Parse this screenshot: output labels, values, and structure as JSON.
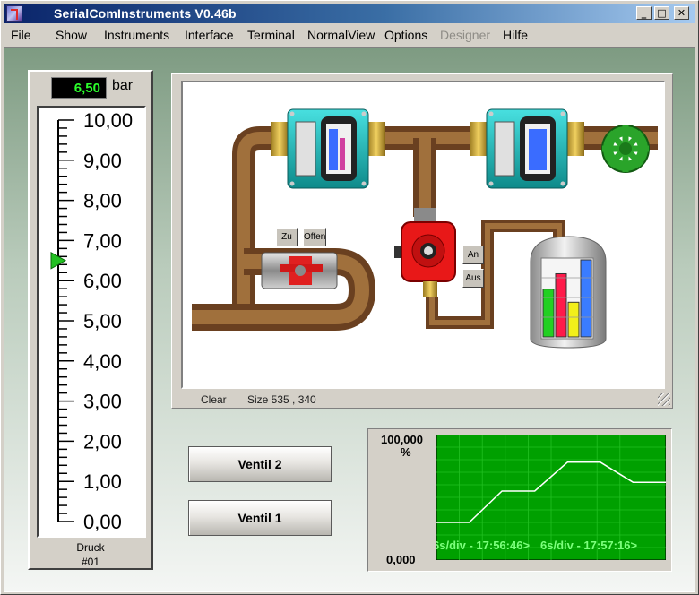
{
  "window": {
    "title": "SerialComInstruments  V0.46b",
    "buttons": [
      "_",
      "□",
      "✕"
    ]
  },
  "menu": [
    {
      "label": "File",
      "disabled": false
    },
    {
      "label": "Show",
      "disabled": false
    },
    {
      "label": "Instruments",
      "disabled": false
    },
    {
      "label": "Interface",
      "disabled": false
    },
    {
      "label": "Terminal",
      "disabled": false
    },
    {
      "label": "NormalView",
      "disabled": false
    },
    {
      "label": "Options",
      "disabled": false
    },
    {
      "label": "Designer",
      "disabled": true
    },
    {
      "label": "Hilfe",
      "disabled": false
    }
  ],
  "gauge": {
    "value_display": "6,50",
    "value": 6.5,
    "unit": "bar",
    "min": 0,
    "max": 10,
    "ticks": [
      "10,00",
      "9,00",
      "8,00",
      "7,00",
      "6,00",
      "5,00",
      "4,00",
      "3,00",
      "2,00",
      "1,00",
      "0,00"
    ],
    "name": "Druck",
    "id": "#01",
    "pointer_color": "#22c022"
  },
  "diagram": {
    "valve_buttons": {
      "close": "Zu",
      "open": "Offen"
    },
    "pump_buttons": {
      "on": "An",
      "off": "Aus"
    },
    "status_clear": "Clear",
    "status_size": "Size 535 , 340",
    "pipe_color": "#8b5a2b",
    "tank_bars": [
      {
        "color": "#22d022",
        "level": 0.62
      },
      {
        "color": "#ff1a4a",
        "level": 0.82
      },
      {
        "color": "#f2ef1a",
        "level": 0.45
      },
      {
        "color": "#3a7cff",
        "level": 1.0
      }
    ]
  },
  "controls": {
    "ventil2": "Ventil 2",
    "ventil1": "Ventil 1"
  },
  "trend": {
    "max_label": "100,000",
    "unit": "%",
    "min_label": "0,000",
    "time_label_1": "6s/div - 17:56:46>",
    "time_label_2": "6s/div - 17:57:16>",
    "background": "#00a000",
    "line_color": "#ffffff",
    "steps": [
      30,
      30,
      55,
      55,
      78,
      78,
      62,
      62
    ]
  }
}
